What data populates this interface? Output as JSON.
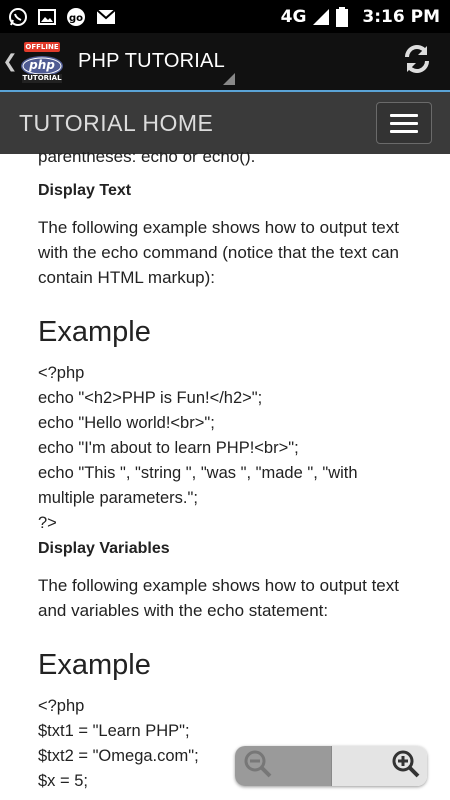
{
  "status_bar": {
    "network": "4G",
    "time": "3:16 PM"
  },
  "app_bar": {
    "logo_badge": "OFFLINE",
    "logo_word": "php",
    "logo_sub": "TUTORIAL",
    "title": "PHP TUTORIAL"
  },
  "nav_bar": {
    "title": "TUTORIAL HOME"
  },
  "content": {
    "intro_fragment": "parentheses: echo or echo().",
    "section1_heading": "Display Text",
    "section1_paragraph": "The following example shows how to output text with the echo command (notice that the text can contain HTML markup):",
    "example1_heading": "Example",
    "example1_code": [
      "<?php",
      "echo \"<h2>PHP is Fun!</h2>\";",
      "echo \"Hello world!<br>\";",
      "echo \"I'm about to learn PHP!<br>\";",
      "echo \"This \", \"string \", \"was \", \"made \", \"with multiple parameters.\";",
      "?>"
    ],
    "section2_heading": "Display Variables",
    "section2_paragraph": "The following example shows how to output text and variables with the echo statement:",
    "example2_heading": "Example",
    "example2_code": [
      "<?php",
      "$txt1 = \"Learn PHP\";",
      "$txt2 = \"Omega.com\";",
      "$x = 5;"
    ]
  }
}
